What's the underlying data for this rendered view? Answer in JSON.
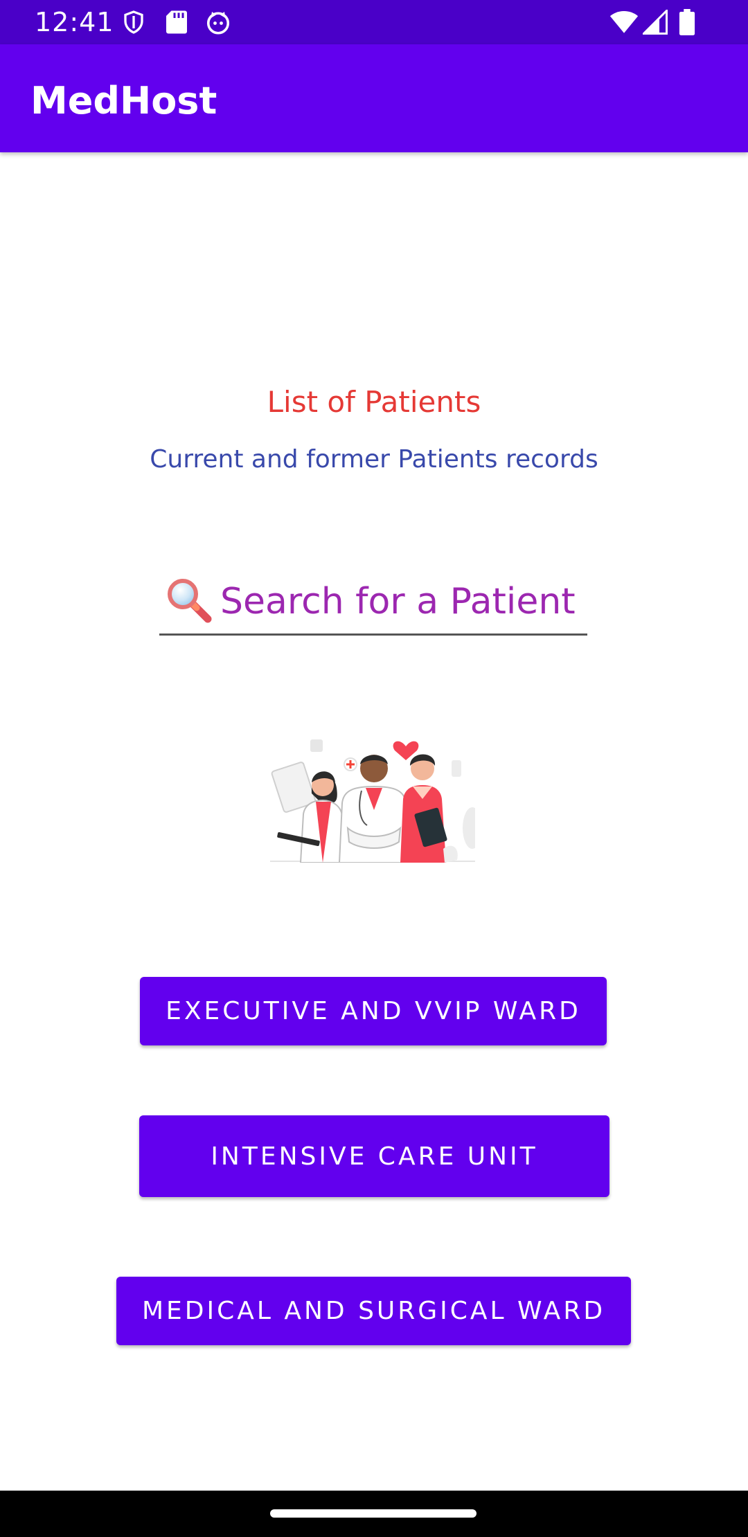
{
  "status_bar": {
    "time": "12:41",
    "left_icons": [
      "shield-icon",
      "sd-card-icon",
      "cat-face-icon"
    ],
    "right_icons": [
      "wifi-icon",
      "cellular-signal-icon",
      "battery-icon"
    ]
  },
  "app_bar": {
    "title": "MedHost"
  },
  "main": {
    "heading": "List of Patients",
    "subheading": "Current and former Patients records",
    "search": {
      "placeholder": "Search for a Patient",
      "value": "",
      "icon": "magnifier-icon"
    },
    "illustration": "medical-staff-illustration",
    "buttons": [
      {
        "label": "EXECUTIVE AND VVIP WARD"
      },
      {
        "label": "INTENSIVE CARE UNIT"
      },
      {
        "label": "MEDICAL AND SURGICAL WARD"
      }
    ]
  },
  "colors": {
    "status_bar": "#4a00c8",
    "primary": "#6200ee",
    "heading": "#e53935",
    "subheading": "#3949ab",
    "search_text": "#9c27b0"
  }
}
